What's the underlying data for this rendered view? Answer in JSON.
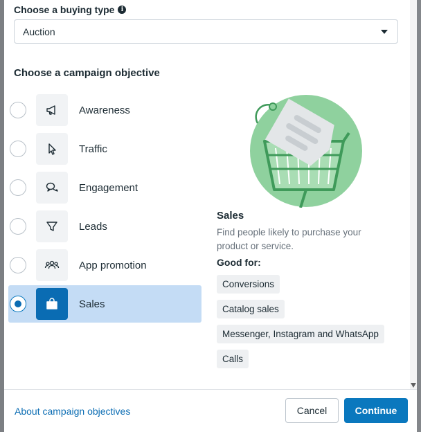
{
  "buying_type": {
    "label": "Choose a buying type",
    "info_icon": "info-icon",
    "selected": "Auction"
  },
  "objective": {
    "title": "Choose a campaign objective",
    "options": [
      {
        "label": "Awareness",
        "icon": "megaphone-icon",
        "selected": false
      },
      {
        "label": "Traffic",
        "icon": "cursor-icon",
        "selected": false
      },
      {
        "label": "Engagement",
        "icon": "chat-bubbles-icon",
        "selected": false
      },
      {
        "label": "Leads",
        "icon": "funnel-icon",
        "selected": false
      },
      {
        "label": "App promotion",
        "icon": "people-icon",
        "selected": false
      },
      {
        "label": "Sales",
        "icon": "shopping-bag-icon",
        "selected": true
      }
    ]
  },
  "detail": {
    "title": "Sales",
    "description": "Find people likely to purchase your product or service.",
    "good_for_label": "Good for:",
    "good_for": [
      "Conversions",
      "Catalog sales",
      "Messenger, Instagram and WhatsApp",
      "Calls"
    ]
  },
  "footer": {
    "link": "About campaign objectives",
    "cancel": "Cancel",
    "continue": "Continue"
  },
  "colors": {
    "accent": "#0a78be",
    "selected_bg": "#c4dcf5",
    "illustration_green": "#8fd19e"
  }
}
